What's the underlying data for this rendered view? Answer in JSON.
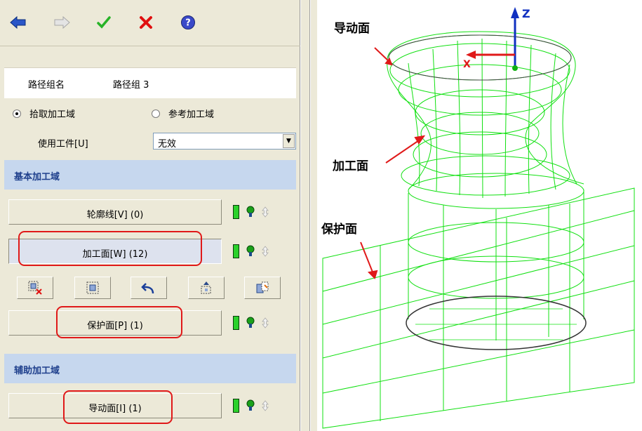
{
  "toolbar": {
    "back_icon": "back-arrow-icon",
    "forward_icon": "forward-arrow-icon",
    "ok_icon": "check-icon",
    "cancel_icon": "close-icon",
    "help_icon": "help-icon"
  },
  "path_group": {
    "label": "路径组名",
    "value": "路径组 3"
  },
  "radios": [
    {
      "label": "拾取加工域",
      "checked": true
    },
    {
      "label": "参考加工域",
      "checked": false
    }
  ],
  "workpiece": {
    "label": "使用工件[U]",
    "value": "无效"
  },
  "sections": {
    "basic": "基本加工域",
    "aux": "辅助加工域"
  },
  "buttons": {
    "contour": "轮廓线[V] (0)",
    "machining": "加工面[W] (12)",
    "protect": "保护面[P] (1)",
    "guide": "导动面[I] (1)"
  },
  "viewport": {
    "annotations": {
      "guide": "导动面",
      "machining": "加工面",
      "protect": "保护面"
    },
    "axes": {
      "z": "Z",
      "x": "X"
    }
  },
  "colors": {
    "wireframe": "#10e010",
    "annotation_arrow": "#e01919",
    "section_bg": "#c6d7ee",
    "section_text": "#1e3f8c"
  }
}
